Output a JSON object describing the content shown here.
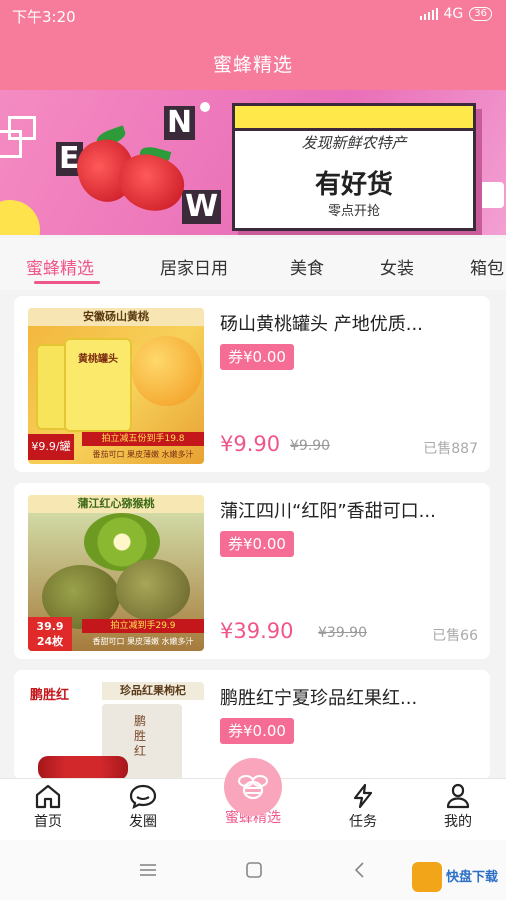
{
  "status": {
    "time": "下午3:20",
    "network": "4G",
    "battery": "36"
  },
  "header": {
    "title": "蜜蜂精选"
  },
  "banner": {
    "letters": [
      "N",
      "E",
      "W"
    ],
    "line1": "发现新鲜农特产",
    "line2": "有好货",
    "line3": "零点开抢"
  },
  "tabs": [
    {
      "label": "蜜蜂精选",
      "active": true
    },
    {
      "label": "居家日用"
    },
    {
      "label": "美食"
    },
    {
      "label": "女装"
    },
    {
      "label": "箱包"
    }
  ],
  "products": [
    {
      "title": "砀山黄桃罐头 产地优质...",
      "coupon": "券¥0.00",
      "price": "¥9.90",
      "original_price": "¥9.90",
      "sold": "已售887",
      "image": {
        "top_label": "安徽砀山黄桃",
        "can_text": "黄桃罐头",
        "badge": "¥9.9/罐",
        "promo": "拍立减五份到手19.8",
        "tags": "番茄可口  果皮薄嫩  水嫩多汁"
      }
    },
    {
      "title": "蒲江四川“红阳”香甜可口...",
      "coupon": "券¥0.00",
      "price": "¥39.90",
      "original_price": "¥39.90",
      "sold": "已售66",
      "image": {
        "top_label": "蒲江红心猕猴桃",
        "badge": "39.9 24枚",
        "promo": "拍立减到手29.9",
        "tags": "香甜可口  果皮薄嫩  水嫩多汁"
      }
    },
    {
      "title": "鹏胜红宁夏珍品红果红...",
      "coupon": "券¥0.00",
      "price": "",
      "original_price": "",
      "sold": "",
      "image": {
        "brand": "鹏胜红",
        "top_label": "珍品红果枸杞",
        "bag_text": "鹏胜红"
      }
    }
  ],
  "tabbar": [
    {
      "label": "首页",
      "icon": "home-icon"
    },
    {
      "label": "发圈",
      "icon": "chat-bubble-icon"
    },
    {
      "label": "蜜蜂精选",
      "icon": "bee-icon",
      "active": true
    },
    {
      "label": "任务",
      "icon": "lightning-icon"
    },
    {
      "label": "我的",
      "icon": "user-icon"
    }
  ],
  "watermark": {
    "text": "快盘下载"
  },
  "colors": {
    "accent": "#f0568a",
    "header": "#f77b9a",
    "coupon": "#f56c95"
  }
}
